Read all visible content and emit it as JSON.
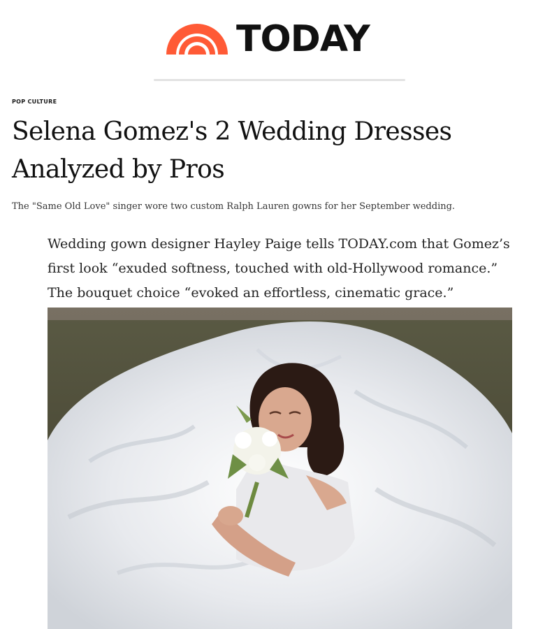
{
  "brand": {
    "name": "TODAY",
    "logo_colors": [
      "#ff5a36",
      "#ff7a4d"
    ],
    "logo_icon": "rainbow-icon"
  },
  "article": {
    "category": "POP CULTURE",
    "headline": "Selena Gomez's 2 Wedding Dresses Analyzed by Pros",
    "dek": "The \"Same Old Love\" singer wore two custom Ralph Lauren gowns for her September wedding.",
    "quote": "Wedding gown designer Hayley Paige tells TODAY.com that Gomez’s first look “exuded softness, touched with old-Hollywood romance.” The bouquet choice “evoked an effortless, cinematic grace.”"
  },
  "photo": {
    "subject": "bride-in-white-gown-with-bouquet-icon",
    "colors": {
      "grass": "#4a4631",
      "gown": "#e9ebee",
      "hair": "#2b1a14",
      "skin": "#d9a88f",
      "bouquet": "#f3f3ea"
    }
  }
}
